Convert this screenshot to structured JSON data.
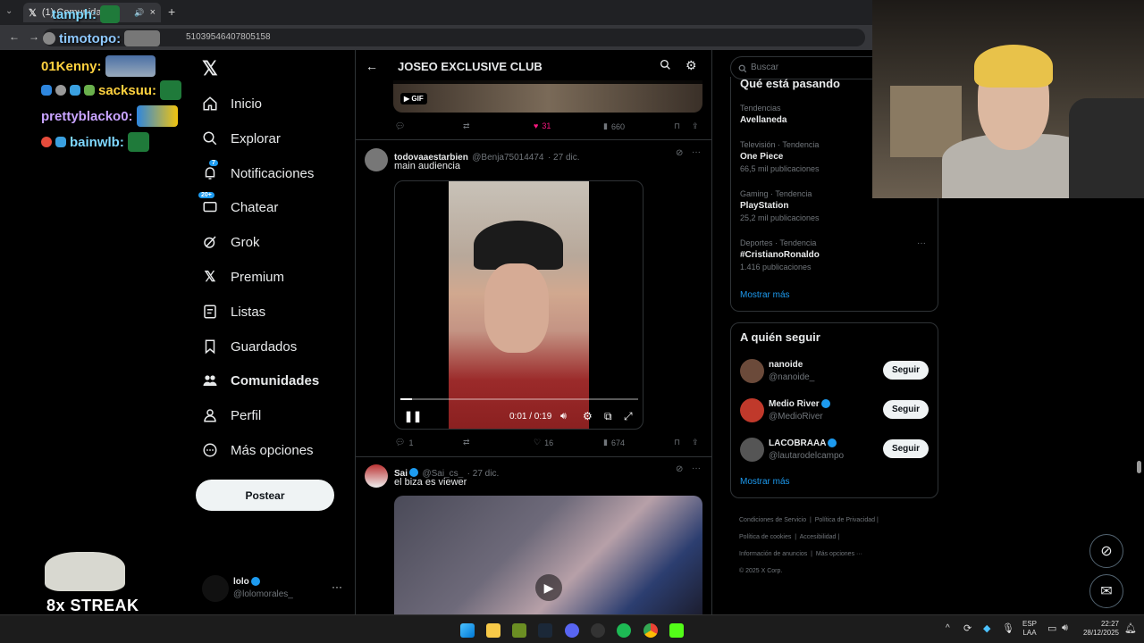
{
  "browser": {
    "tab_title": "(1) Comunidad...",
    "url": "51039546407805158"
  },
  "chat": [
    {
      "user": "tamph:",
      "color": "#7fd8ff"
    },
    {
      "user": "timotopo:",
      "color": "#8fc9ff"
    },
    {
      "user": "01Kenny:",
      "color": "#ffd23f"
    },
    {
      "user": "sacksuu:",
      "color": "#ffd23f"
    },
    {
      "user": "prettyblacko0:",
      "color": "#c9a4ff"
    },
    {
      "user": "bainwlb:",
      "color": "#7fd8ff"
    }
  ],
  "streak": "8x STREAK",
  "sidebar": {
    "items": [
      {
        "label": "Inicio",
        "icon": "home-icon"
      },
      {
        "label": "Explorar",
        "icon": "search-icon"
      },
      {
        "label": "Notificaciones",
        "icon": "bell-icon",
        "badge": "7"
      },
      {
        "label": "Chatear",
        "icon": "chat-icon",
        "badge": "20+"
      },
      {
        "label": "Grok",
        "icon": "grok-icon"
      },
      {
        "label": "Premium",
        "icon": "x-logo-icon"
      },
      {
        "label": "Listas",
        "icon": "list-icon"
      },
      {
        "label": "Guardados",
        "icon": "bookmark-icon"
      },
      {
        "label": "Comunidades",
        "icon": "communities-icon"
      },
      {
        "label": "Perfil",
        "icon": "profile-icon"
      },
      {
        "label": "Más opciones",
        "icon": "more-icon"
      }
    ],
    "post_label": "Postear",
    "account": {
      "name": "lolo",
      "handle": "@lolomorales_"
    }
  },
  "community": {
    "title": "JOSEO EXCLUSIVE CLUB"
  },
  "gif_tag": "GIF",
  "top_post_stats": {
    "replies": "",
    "reposts": "",
    "likes": "31",
    "views": "660"
  },
  "tweet1": {
    "name": "todovaaestarbien",
    "handle": "@Benja75014474",
    "date": "· 27 dic.",
    "text": "main audiencia",
    "video_time": "0:01 / 0:19",
    "video_progress": 0.05,
    "stats": {
      "replies": "1",
      "reposts": "",
      "likes": "16",
      "views": "674"
    }
  },
  "tweet2": {
    "name": "Sai",
    "handle": "@Sai_cs_",
    "date": "· 27 dic.",
    "text": "el biza es viewer"
  },
  "search": {
    "placeholder": "Buscar"
  },
  "trends": {
    "title": "Qué está pasando",
    "items": [
      {
        "meta": "Tendencias",
        "name": "Avellaneda",
        "count": ""
      },
      {
        "meta": "Televisión · Tendencia",
        "name": "One Piece",
        "count": "66,5 mil publicaciones"
      },
      {
        "meta": "Gaming · Tendencia",
        "name": "PlayStation",
        "count": "25,2 mil publicaciones"
      },
      {
        "meta": "Deportes · Tendencia",
        "name": "#CristianoRonaldo",
        "count": "1.416 publicaciones"
      }
    ],
    "more": "Mostrar más"
  },
  "who_to_follow": {
    "title": "A quién seguir",
    "items": [
      {
        "name": "nanoide",
        "handle": "@nanoide_",
        "verified": false,
        "avatar": "#6b4a3a"
      },
      {
        "name": "Medio River",
        "handle": "@MedioRiver",
        "verified": true,
        "avatar": "#c0392b"
      },
      {
        "name": "LACOBRAAA",
        "handle": "@lautarodelcampo",
        "verified": true,
        "avatar": "#555"
      }
    ],
    "follow_label": "Seguir",
    "more": "Mostrar más"
  },
  "footer": {
    "links": [
      "Condiciones de Servicio",
      "Política de Privacidad",
      "Política de cookies",
      "Accesibilidad",
      "Información de anuncios",
      "Más opciones ···"
    ],
    "copyright": "© 2025 X Corp."
  },
  "taskbar": {
    "lang": "ESP",
    "layout": "LAA",
    "time": "22:27",
    "date": "28/12/2025"
  },
  "colors": {
    "accent": "#1d9bf0",
    "like": "#f91880"
  }
}
